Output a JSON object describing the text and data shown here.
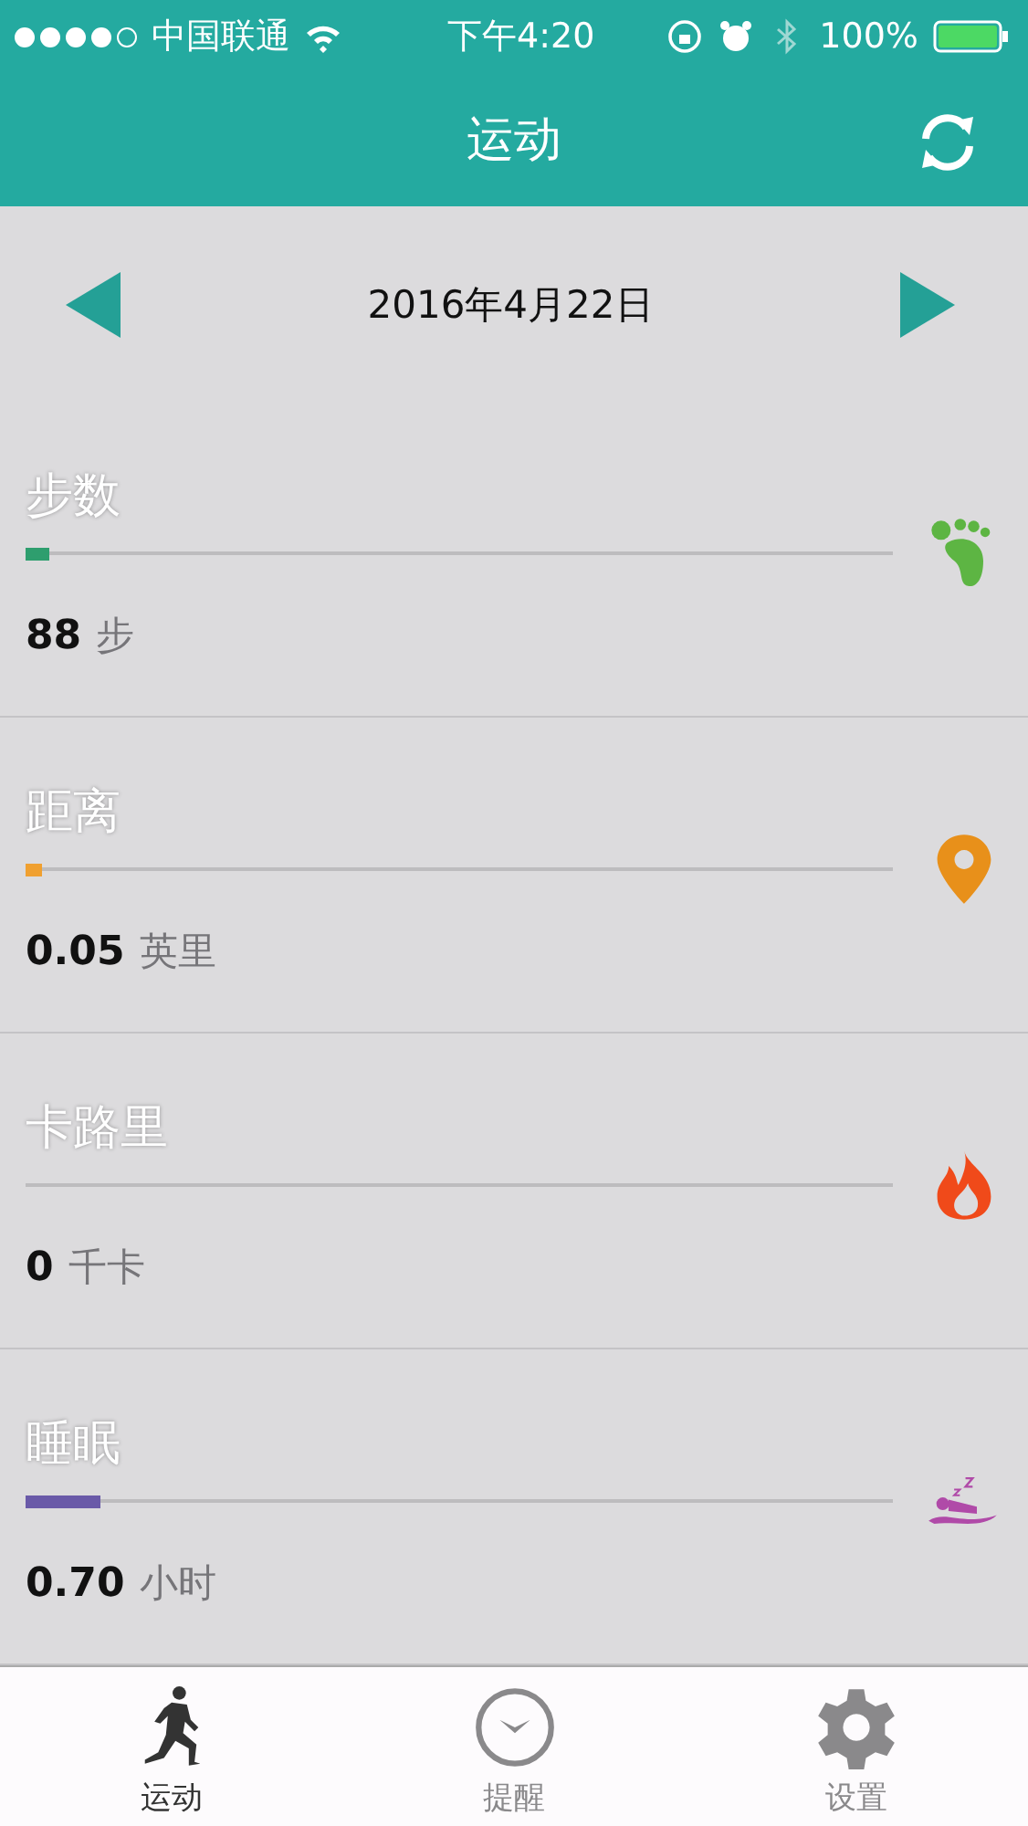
{
  "status_bar": {
    "carrier": "中国联通",
    "time": "下午4:20",
    "battery": "100%"
  },
  "nav": {
    "title": "运动"
  },
  "date": "2016年4月22日",
  "metrics": [
    {
      "kind": "steps",
      "label": "步数",
      "value": "88",
      "unit": "步",
      "level": 0.028,
      "color": "#5db543"
    },
    {
      "kind": "distance",
      "label": "距离",
      "value": "0.05",
      "unit": "英里",
      "level": 0.018,
      "color": "#e8901a"
    },
    {
      "kind": "calories",
      "label": "卡路里",
      "value": "0",
      "unit": "千卡",
      "color": "#f04a1a"
    },
    {
      "kind": "sleep",
      "label": "睡眠",
      "value": "0.70",
      "unit": "小时",
      "level": 0.087,
      "color": "#b04aa8"
    }
  ],
  "tabs": [
    {
      "kind": "run",
      "label": "运动",
      "selected": true
    },
    {
      "kind": "clock",
      "label": "提醒",
      "selected": false
    },
    {
      "kind": "gear",
      "label": "设置",
      "selected": false
    }
  ]
}
